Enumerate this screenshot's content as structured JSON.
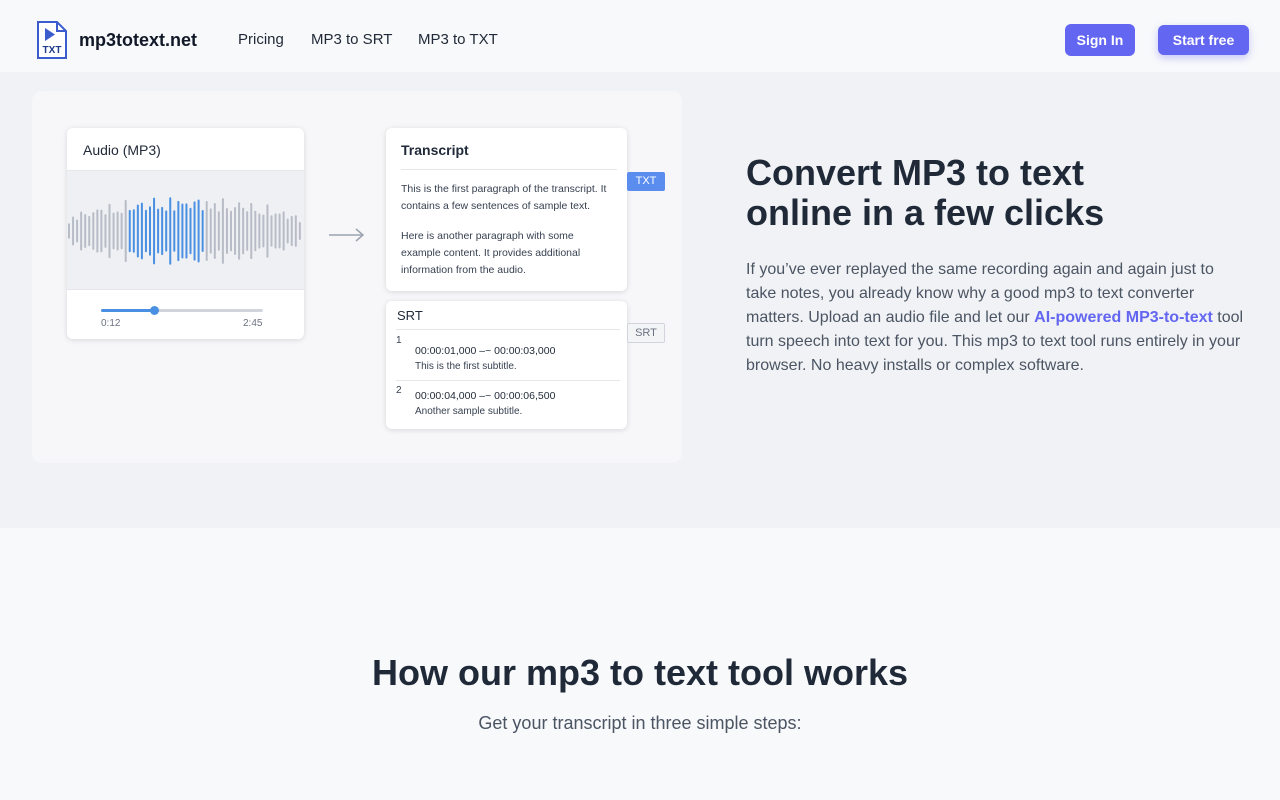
{
  "header": {
    "brand": "mp3totext.net",
    "logo_text": "TXT",
    "nav": [
      {
        "label": "Pricing"
      },
      {
        "label": "MP3 to SRT"
      },
      {
        "label": "MP3 to TXT"
      }
    ],
    "signin_label": "Sign In",
    "start_label": "Start free"
  },
  "illustration": {
    "audio": {
      "title": "Audio (MP3)",
      "current_time": "0:12",
      "total_time": "2:45",
      "progress": 0.33
    },
    "transcript": {
      "title": "Transcript",
      "paragraphs": [
        "This is the first paragraph of the transcript. It contains a few sentences of sample text.",
        "Here is another paragraph with some example content. It provides additional information from the audio."
      ],
      "tag": "TXT"
    },
    "srt": {
      "title": "SRT",
      "entries": [
        {
          "num": "1",
          "time": "00:00:01,000 –~ 00:00:03,000",
          "text": "This is the first subtitle."
        },
        {
          "num": "2",
          "time": "00:00:04,000 –~ 00:00:06,500",
          "text": "Another sample subtitle."
        }
      ],
      "tag": "SRT"
    }
  },
  "hero": {
    "title_line1": "Convert MP3 to text",
    "title_line2": "online in a few clicks",
    "desc_before": "If you’ve ever replayed the same recording again and again just to take notes, you already know why a good mp3 to text converter matters. Upload an audio file and let our ",
    "desc_link": "AI-powered MP3-to-text",
    "desc_after": " tool turn speech into text for you. This mp3 to text tool runs entirely in your browser. No heavy installs or complex software."
  },
  "how_it_works": {
    "title": "How our mp3 to text tool works",
    "subtitle": "Get your transcript in three simple steps:"
  },
  "colors": {
    "accent": "#6366f1",
    "wave_blue": "#4a90e2",
    "wave_gray": "#b7bcc6"
  }
}
